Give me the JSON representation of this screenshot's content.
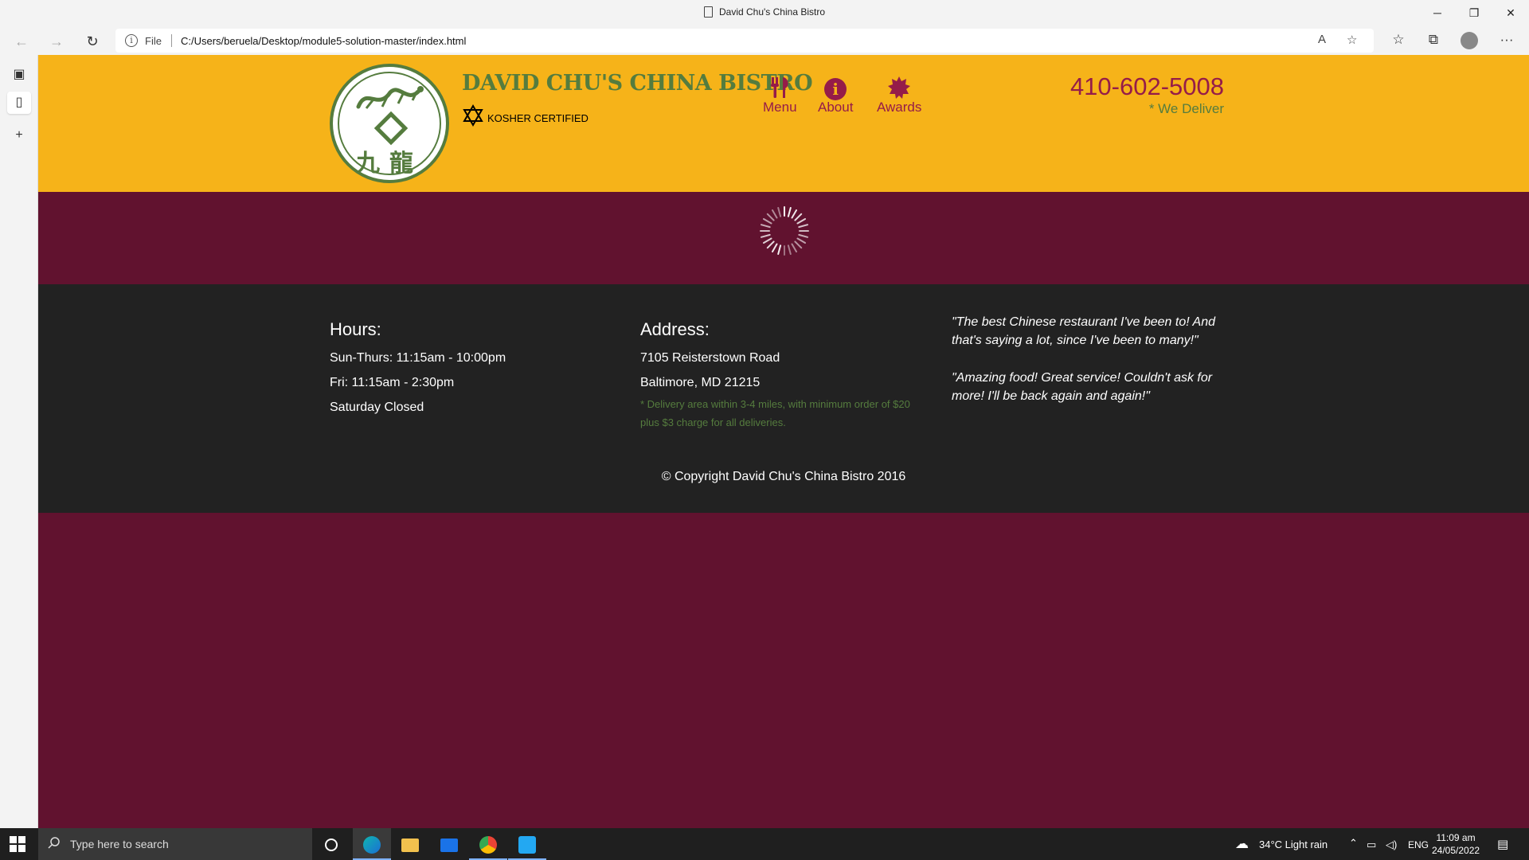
{
  "window": {
    "title": "David Chu's China Bistro",
    "minimize": "─",
    "restore": "❐",
    "close": "✕"
  },
  "toolbar": {
    "back": "←",
    "forward": "→",
    "refresh": "↻",
    "info_glyph": "i",
    "scheme_label": "File",
    "url": "C:/Users/beruela/Desktop/module5-solution-master/index.html",
    "read_aloud": "A",
    "add_favorite": "☆",
    "favorites": "☆",
    "collections": "⧉",
    "more": "···"
  },
  "sidebar": {
    "tabs_glyph": "▣",
    "page_glyph": "▯",
    "add_glyph": "+"
  },
  "site": {
    "brand": "DAVID CHU'S CHINA BISTRO",
    "kosher": "KOSHER CERTIFIED",
    "logo_chars": "九龍",
    "nav": [
      {
        "label": "Menu",
        "icon": "utensils-icon"
      },
      {
        "label": "About",
        "icon": "info-circle-icon"
      },
      {
        "label": "Awards",
        "icon": "certificate-icon"
      }
    ],
    "phone": "410-602-5008",
    "deliver": "* We Deliver",
    "colors": {
      "header": "#f6b319",
      "accent": "#951c49",
      "green": "#557c3e",
      "body": "#61122f",
      "footer": "#222222"
    }
  },
  "footer": {
    "hours": {
      "heading": "Hours:",
      "lines": [
        "Sun-Thurs: 11:15am - 10:00pm",
        "Fri: 11:15am - 2:30pm",
        "Saturday Closed"
      ]
    },
    "address": {
      "heading": "Address:",
      "lines": [
        "7105 Reisterstown Road",
        "Baltimore, MD 21215"
      ],
      "note": "* Delivery area within 3-4 miles, with minimum order of $20 plus $3 charge for all deliveries."
    },
    "quotes": [
      "\"The best Chinese restaurant I've been to! And that's saying a lot, since I've been to many!\"",
      "\"Amazing food! Great service! Couldn't ask for more! I'll be back again and again!\""
    ],
    "copyright": "© Copyright David Chu's China Bistro 2016"
  },
  "taskbar": {
    "search_placeholder": "Type here to search",
    "weather": "34°C  Light rain",
    "lang": "ENG",
    "time": "11:09 am",
    "date": "24/05/2022"
  }
}
